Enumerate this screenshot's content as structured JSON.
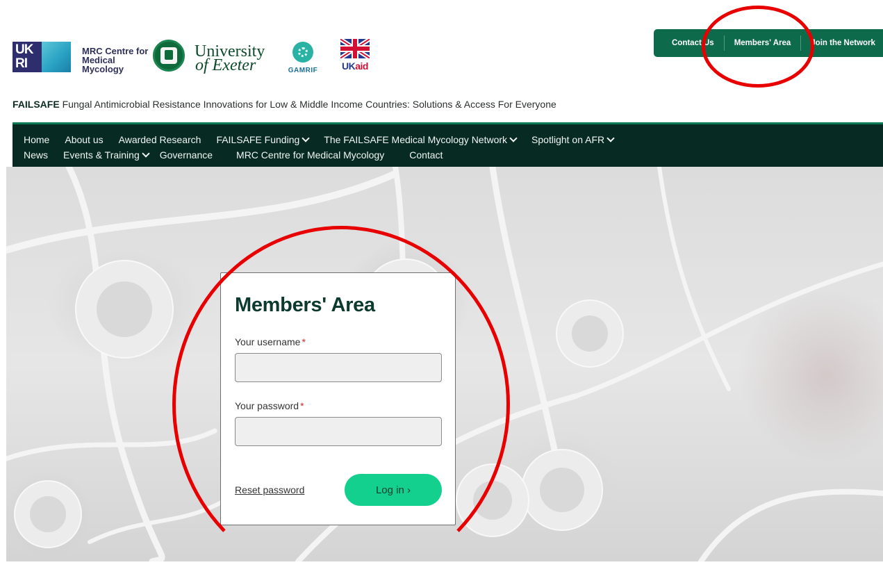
{
  "logos": {
    "ukri_text": [
      "UK",
      "RI"
    ],
    "mrc_name": "MRC Centre for Medical Mycology",
    "exeter_line1": "University",
    "exeter_line2": "of Exeter",
    "gamrif": "GAMRIF",
    "ukaid_uk": "UK",
    "ukaid_aid": "aid"
  },
  "utility_nav": {
    "items": [
      {
        "label": "Contact Us"
      },
      {
        "label": "Members' Area"
      },
      {
        "label": "Join the Network"
      }
    ]
  },
  "tagline": {
    "brand": "FAILSAFE",
    "text": "Fungal Antimicrobial Resistance Innovations for Low & Middle Income Countries: Solutions & Access For Everyone"
  },
  "main_nav": {
    "row1": [
      {
        "label": "Home"
      },
      {
        "label": "About us"
      },
      {
        "label": "Awarded Research"
      },
      {
        "label": "FAILSAFE Funding"
      },
      {
        "label": "The FAILSAFE Medical Mycology Network"
      },
      {
        "label": "Spotlight on AFR"
      }
    ],
    "row2": [
      {
        "label": "News"
      },
      {
        "label": "Events & Training"
      },
      {
        "label": "Governance"
      },
      {
        "label": "MRC Centre for Medical Mycology"
      },
      {
        "label": "Contact"
      }
    ]
  },
  "login": {
    "title": "Members' Area",
    "username_label": "Your username",
    "password_label": "Your password",
    "required_mark": "*",
    "username_value": "",
    "password_value": "",
    "reset_label": "Reset password",
    "login_label": "Log in ›"
  },
  "colors": {
    "header_green": "#0d6b4c",
    "nav_dark": "#072a22",
    "login_button": "#14d08f",
    "annotation_red": "#e80000"
  }
}
